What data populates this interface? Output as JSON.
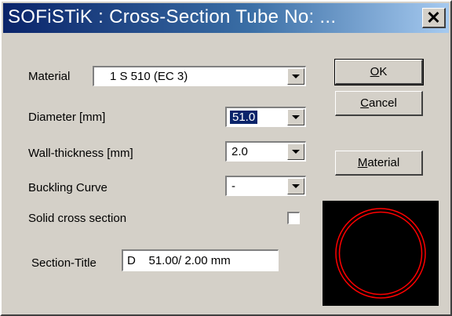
{
  "window": {
    "title": "SOFiSTiK : Cross-Section Tube No:  ...",
    "close_glyph": "✕"
  },
  "form": {
    "material": {
      "label": "Material",
      "value": "1 S 510 (EC 3)"
    },
    "diameter": {
      "label": "Diameter [mm]",
      "value": "51.0"
    },
    "wall_thickness": {
      "label": "Wall-thickness [mm]",
      "value": "2.0"
    },
    "buckling_curve": {
      "label": "Buckling Curve",
      "value": "-"
    },
    "solid_cross_section": {
      "label": "Solid cross section",
      "checked": false
    },
    "section_title": {
      "label": "Section-Title",
      "value": "D    51.00/ 2.00 mm"
    }
  },
  "buttons": {
    "ok": {
      "accel": "O",
      "rest": "K"
    },
    "cancel": {
      "accel": "C",
      "rest": "ancel"
    },
    "material": {
      "accel": "M",
      "rest": "aterial"
    }
  },
  "preview": {
    "shape": "tube-cross-section",
    "background": "#000000",
    "stroke_color": "#ff0000"
  }
}
